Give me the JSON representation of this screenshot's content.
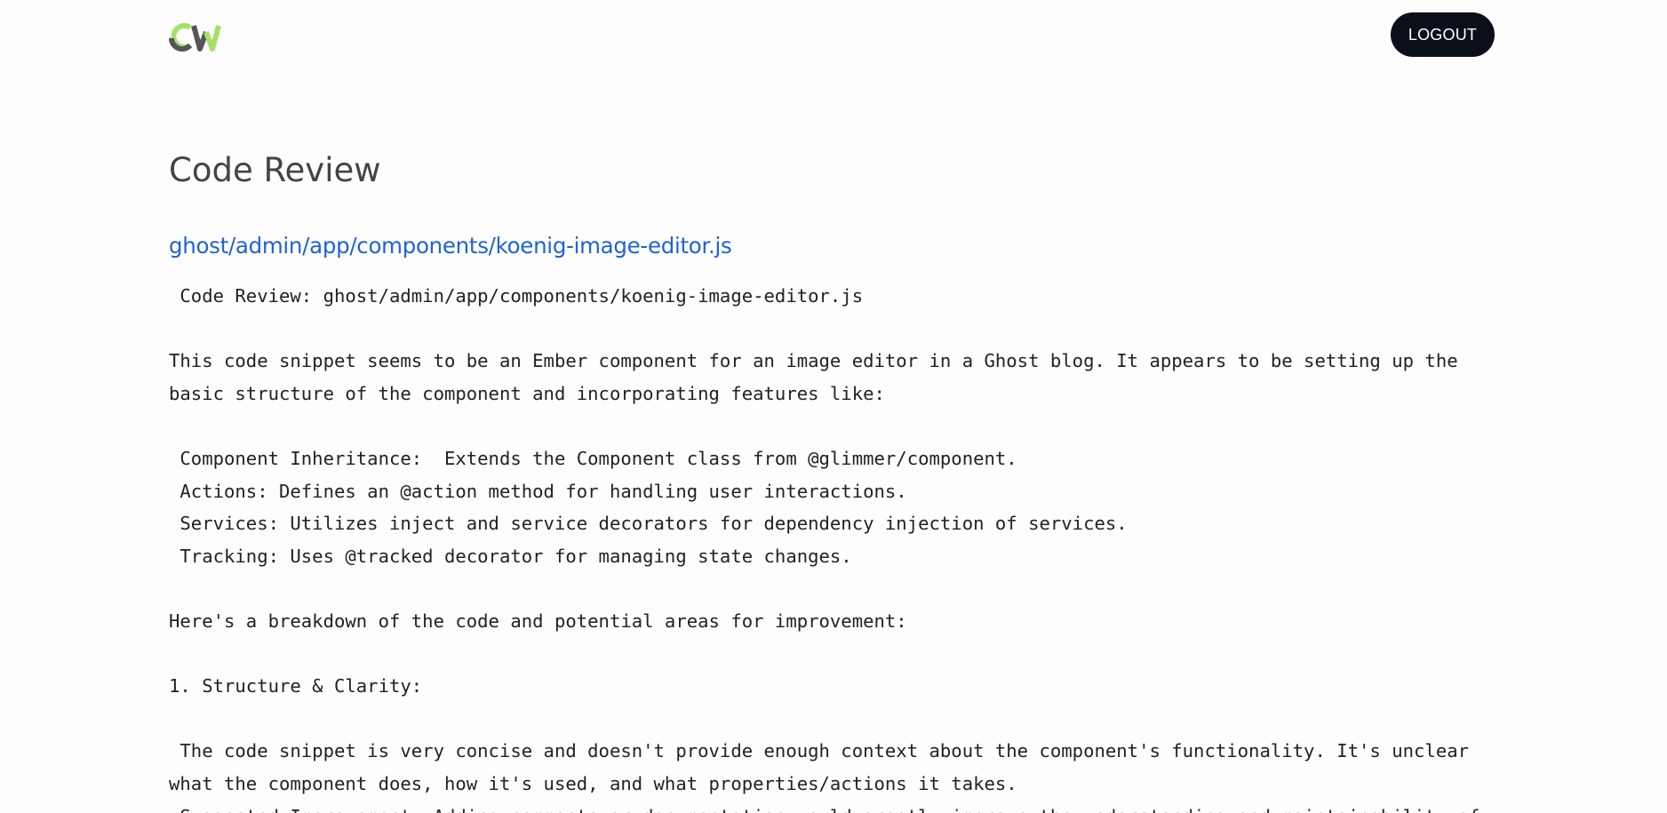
{
  "header": {
    "logo_text": "CW",
    "logout_label": "LOGOUT"
  },
  "main": {
    "title": "Code Review",
    "file_link": "ghost/admin/app/components/koenig-image-editor.js",
    "lines": [
      " Code Review: ghost/admin/app/components/koenig-image-editor.js",
      "",
      "This code snippet seems to be an Ember component for an image editor in a Ghost blog. It appears to be setting up the",
      "basic structure of the component and incorporating features like:",
      "",
      " Component Inheritance:  Extends the Component class from @glimmer/component.",
      " Actions: Defines an @action method for handling user interactions.",
      " Services: Utilizes inject and service decorators for dependency injection of services.",
      " Tracking: Uses @tracked decorator for managing state changes.",
      "",
      "Here's a breakdown of the code and potential areas for improvement:",
      "",
      "1. Structure & Clarity:",
      "",
      " The code snippet is very concise and doesn't provide enough context about the component's functionality. It's unclear",
      "what the component does, how it's used, and what properties/actions it takes.",
      " Suggested Improvement: Adding comments or documentation would greatly improve the understanding and maintainability of"
    ]
  },
  "colors": {
    "logo_green": "#a6e06a",
    "logo_gray": "#555555",
    "logout_bg": "#0b0f19",
    "link": "#1f63d6"
  }
}
